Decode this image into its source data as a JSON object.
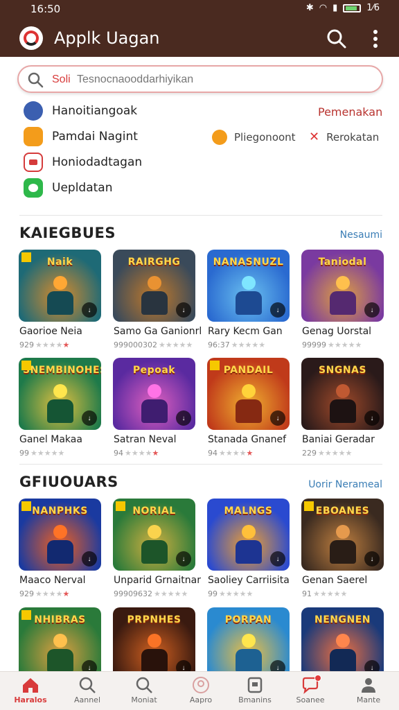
{
  "status": {
    "time": "16:50",
    "right": "1⁄6"
  },
  "app": {
    "title": "Applk Uagan"
  },
  "search": {
    "prefix": "Soli",
    "placeholder": "Tesnocnaooddarhiyikan"
  },
  "categories": [
    {
      "label": "Hanoitiangoak",
      "color": "#3b5fb0"
    },
    {
      "label": "Pamdai Nagint",
      "color": "#f39c1b"
    },
    {
      "label": "Honiodadtagan",
      "color": "#d53b3b"
    },
    {
      "label": "Uepldatan",
      "color": "#2eb84a"
    }
  ],
  "side_links": {
    "top": "Pemenakan",
    "mid": "Pliegonoont",
    "right": "Rerokatan"
  },
  "sections": [
    {
      "title": "KAIEGBUES",
      "link": "Nesaumi",
      "games": [
        {
          "name": "Gaorioe Neia",
          "rating": "929",
          "reds": 1,
          "art": "Naik",
          "bg1": "#1e6a76",
          "bg2": "#d98b2b"
        },
        {
          "name": "Samo Ga Ganionrl",
          "rating": "999000302",
          "reds": 0,
          "art": "RAIRGHG",
          "bg1": "#3a4a5a",
          "bg2": "#c27a2a"
        },
        {
          "name": "Rary Kecm Gan",
          "rating": "96:37",
          "reds": 0,
          "art": "NANASNUZL",
          "bg1": "#2a6ad0",
          "bg2": "#6ac0f0"
        },
        {
          "name": "Genag Uorstal",
          "rating": "99999",
          "reds": 0,
          "art": "Taniodal",
          "bg1": "#7a3aa0",
          "bg2": "#e0a040"
        }
      ]
    },
    {
      "title": "",
      "link": "",
      "games": [
        {
          "name": "Ganel Makaa",
          "rating": "99",
          "reds": 0,
          "art": "SNEMBINOHES",
          "bg1": "#1e7a4a",
          "bg2": "#e0c040"
        },
        {
          "name": "Satran Neval",
          "rating": "94",
          "reds": 1,
          "art": "Pepoak",
          "bg1": "#5a2aa0",
          "bg2": "#e060c0"
        },
        {
          "name": "Stanada Gnanef",
          "rating": "94",
          "reds": 1,
          "art": "PANDAIL",
          "bg1": "#c03a1a",
          "bg2": "#f0b030"
        },
        {
          "name": "Baniai Geradar",
          "rating": "229",
          "reds": 0,
          "art": "SNGNAS",
          "bg1": "#2a1a1a",
          "bg2": "#a04a2a"
        }
      ]
    },
    {
      "title": "GFIUOUARS",
      "link": "Uorir Nerameal",
      "games": [
        {
          "name": "Maaco Nerval",
          "rating": "929",
          "reds": 1,
          "art": "NANPHKS",
          "bg1": "#1a3aa0",
          "bg2": "#f06020"
        },
        {
          "name": "Unparid Grnaitnar",
          "rating": "99909632",
          "reds": 0,
          "art": "NORIAL",
          "bg1": "#2a7a3a",
          "bg2": "#d0b040"
        },
        {
          "name": "Saoliey Carriisita",
          "rating": "99",
          "reds": 0,
          "art": "MALNGS",
          "bg1": "#2a4ad0",
          "bg2": "#f0a030"
        },
        {
          "name": "Genan Saerel",
          "rating": "91",
          "reds": 0,
          "art": "EBOANES",
          "bg1": "#3a2a20",
          "bg2": "#c08040"
        }
      ]
    },
    {
      "title": "",
      "link": "",
      "games": [
        {
          "name": "",
          "rating": "",
          "reds": 0,
          "art": "NHIBRAS",
          "bg1": "#2a7a3a",
          "bg2": "#e0a040"
        },
        {
          "name": "",
          "rating": "",
          "reds": 0,
          "art": "PRPNHES",
          "bg1": "#3a1a10",
          "bg2": "#d06020"
        },
        {
          "name": "",
          "rating": "",
          "reds": 0,
          "art": "PORPAN",
          "bg1": "#2a8ad0",
          "bg2": "#f0c040"
        },
        {
          "name": "",
          "rating": "",
          "reds": 0,
          "art": "NENGNEN",
          "bg1": "#1a3a7a",
          "bg2": "#f07040"
        }
      ]
    }
  ],
  "nav": [
    {
      "label": "Haralos",
      "icon": "home-icon",
      "active": true
    },
    {
      "label": "Aannel",
      "icon": "search-icon",
      "active": false
    },
    {
      "label": "Moniat",
      "icon": "search-icon",
      "active": false
    },
    {
      "label": "Aapro",
      "icon": "profile-circle-icon",
      "active": false
    },
    {
      "label": "Bmanins",
      "icon": "document-icon",
      "active": false
    },
    {
      "label": "Soanee",
      "icon": "chat-icon",
      "active": false,
      "notification": true
    },
    {
      "label": "Mante",
      "icon": "user-icon",
      "active": false
    }
  ],
  "colors": {
    "appbar": "#4a2a20",
    "accent": "#d83b3b",
    "link": "#3a7db5"
  }
}
